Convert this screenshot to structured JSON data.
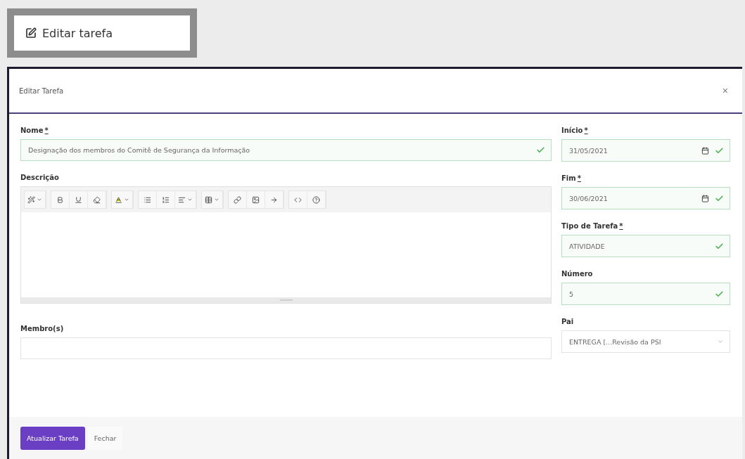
{
  "page_heading": {
    "label": "Editar tarefa"
  },
  "dialog": {
    "title": "Editar Tarefa",
    "close": "×"
  },
  "left_fields": [
    {
      "kind": "text",
      "label": "Nome",
      "required_mark": "*",
      "value": "Designação dos membros do Comitê de Segurança da Informação",
      "valid": true
    },
    {
      "kind": "editor",
      "label": "Descrição"
    },
    {
      "kind": "text",
      "label": "Membro(s)",
      "valid": false
    }
  ],
  "right_fields": [
    {
      "kind": "date",
      "label": "Início",
      "required_mark": "*",
      "value": "31/05/2021",
      "valid": true
    },
    {
      "kind": "date",
      "label": "Fim",
      "required_mark": "*",
      "value": "30/06/2021",
      "valid": true
    },
    {
      "kind": "select",
      "label": "Tipo de Tarefa",
      "required_mark": "*",
      "value": "ATIVIDADE",
      "valid": true
    },
    {
      "kind": "text",
      "label": "Número",
      "value": "5",
      "valid": true
    },
    {
      "kind": "select",
      "label": "Pai",
      "value": "ENTREGA [...Revisão da PSI",
      "valid": false
    }
  ],
  "buttons": [
    {
      "label": "Atualizar Tarefa",
      "kind": "primary"
    },
    {
      "label": "Fechar",
      "kind": "secondary"
    }
  ]
}
